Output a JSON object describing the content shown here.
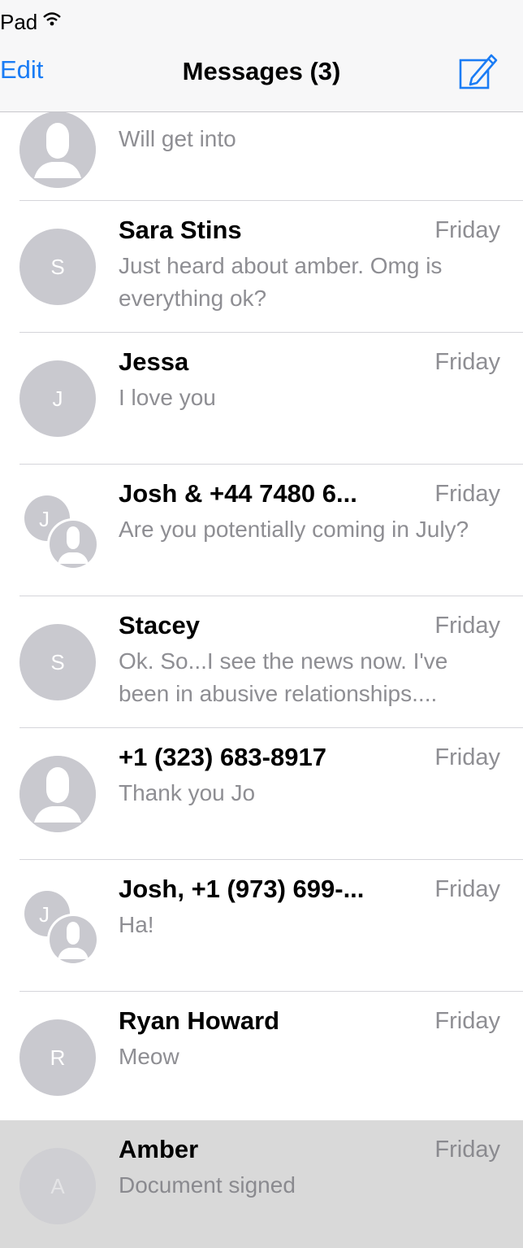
{
  "status_bar": {
    "carrier": "Pad"
  },
  "nav": {
    "edit_label": "Edit",
    "title": "Messages (3)"
  },
  "conversations": [
    {
      "name": "",
      "time": "",
      "preview": "Will get into",
      "avatar": "person-icon"
    },
    {
      "name": "Sara Stins",
      "time": "Friday",
      "preview": "Just heard about amber. Omg is everything ok?",
      "avatar_initial": "S"
    },
    {
      "name": "Jessa",
      "time": "Friday",
      "preview": "I love you",
      "avatar_initial": "J"
    },
    {
      "name": "Josh & +44 7480 6...",
      "time": "Friday",
      "preview": "Are you potentially coming in July?",
      "avatar": "group-icon",
      "avatar_initial": "J"
    },
    {
      "name": "Stacey",
      "time": "Friday",
      "preview": "Ok. So...I see the news now. I've been in abusive relationships....",
      "avatar_initial": "S"
    },
    {
      "name": "+1 (323) 683-8917",
      "time": "Friday",
      "preview": "Thank you Jo",
      "avatar": "person-icon"
    },
    {
      "name": "Josh, +1 (973) 699-...",
      "time": "Friday",
      "preview": "Ha!",
      "avatar": "group-icon",
      "avatar_initial": "J"
    },
    {
      "name": "Ryan Howard",
      "time": "Friday",
      "preview": "Meow",
      "avatar_initial": "R"
    },
    {
      "name": "Amber",
      "time": "Friday",
      "preview": "Document signed",
      "avatar_initial": "A",
      "selected": true
    }
  ],
  "colors": {
    "accent": "#1a7cf5",
    "secondary_text": "#8e8e93",
    "avatar": "#c9c9cf",
    "selected_row": "#d9d9d9"
  }
}
